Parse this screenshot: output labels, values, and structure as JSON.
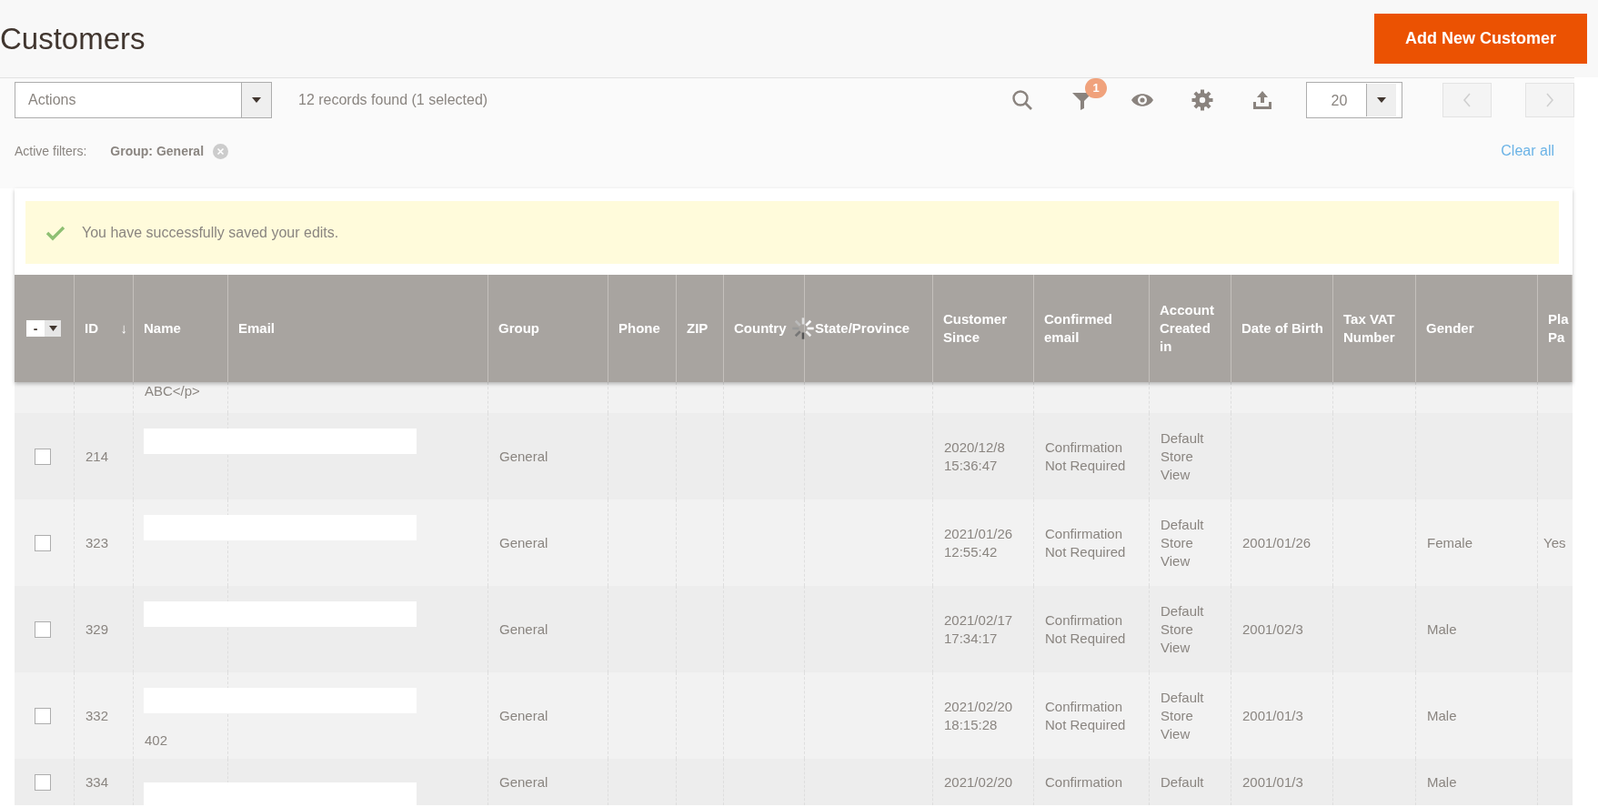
{
  "page": {
    "title": "Customers",
    "add_button": "Add New Customer"
  },
  "toolbar": {
    "actions": "Actions",
    "records_found": "12 records found (1 selected)",
    "filter_count": "1",
    "per_page": "20"
  },
  "active_filters": {
    "label": "Active filters:",
    "filters": [
      {
        "label": "Group: General"
      }
    ],
    "clear_all": "Clear all"
  },
  "message": {
    "text": "You have successfully saved your edits."
  },
  "table": {
    "loading": true,
    "mass_select": "-",
    "columns": [
      {
        "label": "ID",
        "sort_arrow": "↓"
      },
      {
        "label": "Name"
      },
      {
        "label": "Email"
      },
      {
        "label": "Group"
      },
      {
        "label": "Phone"
      },
      {
        "label": "ZIP"
      },
      {
        "label": "Country"
      },
      {
        "label": "State/Province"
      },
      {
        "label": "Customer Since"
      },
      {
        "label": "Confirmed email"
      },
      {
        "label": "Account Created in"
      },
      {
        "label": "Date of Birth"
      },
      {
        "label": "Tax VAT Number"
      },
      {
        "label": "Gender"
      },
      {
        "label": "Pla Pa"
      }
    ],
    "rows": [
      {
        "kind": "partial",
        "name": "ABC</p>"
      },
      {
        "kind": "record",
        "selected": false,
        "redacted": true,
        "id": "214",
        "group": "General",
        "customer_since": "2020/12/8 15:36:47",
        "confirmed_email": "Confirmation Not Required",
        "account_created_in": "Default Store View"
      },
      {
        "kind": "record",
        "selected": false,
        "redacted": true,
        "id": "323",
        "group": "General",
        "customer_since": "2021/01/26 12:55:42",
        "confirmed_email": "Confirmation Not Required",
        "account_created_in": "Default Store View",
        "date_of_birth": "2001/01/26",
        "gender": "Female",
        "column_15": "Yes"
      },
      {
        "kind": "record",
        "selected": false,
        "redacted": true,
        "id": "329",
        "group": "General",
        "customer_since": "2021/02/17 17:34:17",
        "confirmed_email": "Confirmation Not Required",
        "account_created_in": "Default Store View",
        "date_of_birth": "2001/02/3",
        "gender": "Male"
      },
      {
        "kind": "record",
        "selected": false,
        "redacted": true,
        "id": "332",
        "name": "402",
        "group": "General",
        "customer_since": "2021/02/20 18:15:28",
        "confirmed_email": "Confirmation Not Required",
        "account_created_in": "Default Store View",
        "date_of_birth": "2001/01/3",
        "gender": "Male"
      },
      {
        "kind": "cut",
        "selected": false,
        "redacted": true,
        "id": "334",
        "group": "General",
        "customer_since": "2021/02/20",
        "confirmed_email": "Confirmation",
        "account_created_in": "Default",
        "date_of_birth": "2001/01/3",
        "gender": "Male"
      }
    ]
  }
}
